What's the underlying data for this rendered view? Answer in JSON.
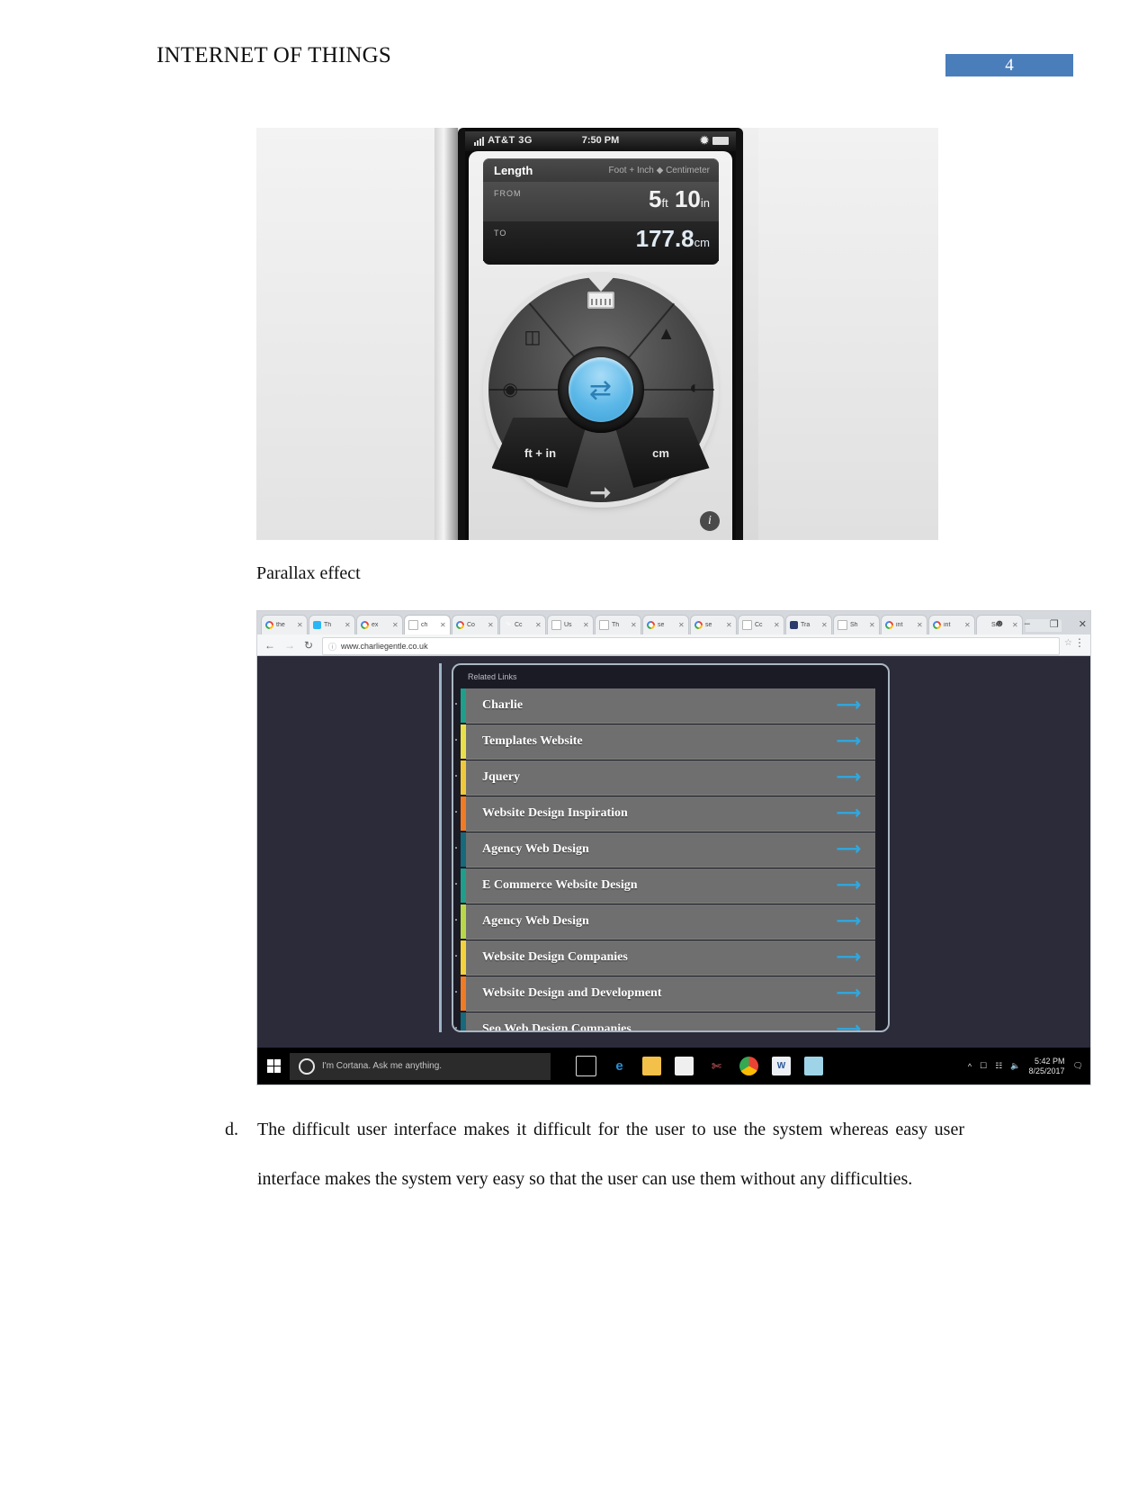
{
  "header": {
    "title": "INTERNET OF THINGS",
    "page_number": "4",
    "accent_color": "#4a7ebb"
  },
  "figure_converter": {
    "status_bar": {
      "carrier": "AT&T",
      "network": "3G",
      "time": "7:50 PM",
      "bluetooth_icon": "bluetooth-icon"
    },
    "panel": {
      "title": "Length",
      "units": "Foot + Inch ◆ Centimeter",
      "from_label": "FROM",
      "from_value": "5",
      "from_unit": "ft",
      "from_value2": "10",
      "from_unit2": "in",
      "to_label": "TO",
      "to_value": "177.8",
      "to_unit": "cm"
    },
    "dial": {
      "left_segment_label": "ft + in",
      "right_segment_label": "cm",
      "center_icon": "swap-arrows-icon",
      "icons": [
        "ruler-icon",
        "screen-size-icon",
        "weight-icon",
        "volume-icon",
        "temperature-icon"
      ],
      "down_arrow_icon": "arrow-right-icon",
      "info_label": "i"
    }
  },
  "caption": "Parallax effect",
  "browser": {
    "tabs": [
      {
        "favicon": "google-icon",
        "label": "the"
      },
      {
        "favicon": "blue-app-icon",
        "label": "Th"
      },
      {
        "favicon": "google-icon",
        "label": "ex"
      },
      {
        "favicon": "document-icon",
        "label": "ch",
        "active": true
      },
      {
        "favicon": "google-icon",
        "label": "Co"
      },
      {
        "favicon": "link-icon",
        "label": "Cc"
      },
      {
        "favicon": "document-icon",
        "label": "Us"
      },
      {
        "favicon": "document-icon",
        "label": "Th"
      },
      {
        "favicon": "google-icon",
        "label": "se"
      },
      {
        "favicon": "google-icon",
        "label": "se"
      },
      {
        "favicon": "document-icon",
        "label": "Cc"
      },
      {
        "favicon": "dark-app-icon",
        "label": "Tra"
      },
      {
        "favicon": "document-icon",
        "label": "Sh"
      },
      {
        "favicon": "google-icon",
        "label": "int"
      },
      {
        "favicon": "google-icon",
        "label": "int"
      },
      {
        "favicon": "blank-icon",
        "label": "Si"
      }
    ],
    "window_controls": {
      "profile_icon": "person-icon",
      "minimize": "–",
      "maximize": "❐",
      "close": "✕"
    },
    "toolbar": {
      "back_icon": "back-arrow-icon",
      "forward_icon": "forward-arrow-icon",
      "reload_icon": "reload-icon",
      "home_icon": "home-icon",
      "security_icon": "info-circle-icon",
      "url": "www.charliegentle.co.uk",
      "bookmark_icon": "star-icon",
      "menu_icon": "kebab-menu-icon"
    },
    "page": {
      "section_title": "Related Links",
      "links": [
        {
          "label": "Charlie",
          "accent": "#1f9e8c"
        },
        {
          "label": "Templates Website",
          "accent": "#e8e04a"
        },
        {
          "label": "Jquery",
          "accent": "#f0c93a"
        },
        {
          "label": "Website Design Inspiration",
          "accent": "#f07b25"
        },
        {
          "label": "Agency Web Design",
          "accent": "#17697c"
        },
        {
          "label": "E Commerce Website Design",
          "accent": "#1f9e8c"
        },
        {
          "label": "Agency Web Design",
          "accent": "#b8d84a"
        },
        {
          "label": "Website Design Companies",
          "accent": "#f3d23c"
        },
        {
          "label": "Website Design and Development",
          "accent": "#f07b25"
        },
        {
          "label": "Seo Web Design Companies",
          "accent": "#17697c"
        }
      ],
      "arrow_icon": "arrow-right-icon",
      "arrow_color": "#2fa8e0"
    },
    "taskbar": {
      "start_icon": "windows-start-icon",
      "cortana_placeholder": "I'm Cortana. Ask me anything.",
      "apps": [
        "task-view-icon",
        "edge-icon",
        "file-explorer-icon",
        "store-icon",
        "snipping-tool-icon",
        "chrome-icon",
        "word-icon",
        "app-icon"
      ],
      "tray": [
        "chevron-up-icon",
        "network-icon",
        "keyboard-icon",
        "volume-icon"
      ],
      "clock_time": "5:42 PM",
      "clock_date": "8/25/2017",
      "notification_icon": "notification-icon"
    }
  },
  "body": {
    "list_marker": "d.",
    "paragraph": "The difficult user interface makes it difficult for the user to use the system whereas easy user interface makes the system very easy so that the user can use them without any difficulties."
  }
}
